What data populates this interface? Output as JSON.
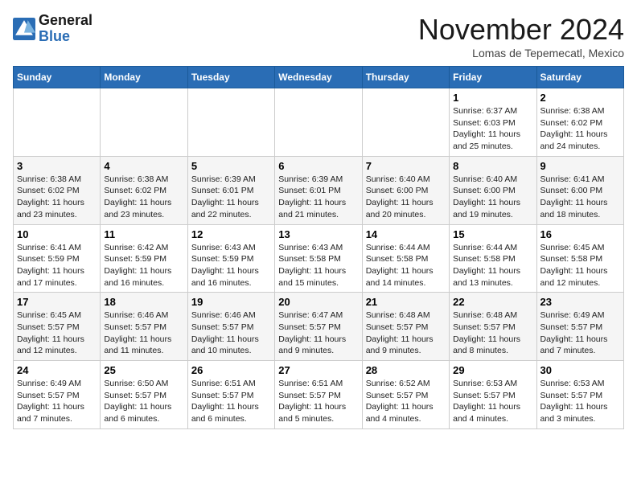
{
  "header": {
    "logo_line1": "General",
    "logo_line2": "Blue",
    "title": "November 2024",
    "location": "Lomas de Tepemecatl, Mexico"
  },
  "days_of_week": [
    "Sunday",
    "Monday",
    "Tuesday",
    "Wednesday",
    "Thursday",
    "Friday",
    "Saturday"
  ],
  "weeks": [
    [
      {
        "day": "",
        "info": ""
      },
      {
        "day": "",
        "info": ""
      },
      {
        "day": "",
        "info": ""
      },
      {
        "day": "",
        "info": ""
      },
      {
        "day": "",
        "info": ""
      },
      {
        "day": "1",
        "info": "Sunrise: 6:37 AM\nSunset: 6:03 PM\nDaylight: 11 hours and 25 minutes."
      },
      {
        "day": "2",
        "info": "Sunrise: 6:38 AM\nSunset: 6:02 PM\nDaylight: 11 hours and 24 minutes."
      }
    ],
    [
      {
        "day": "3",
        "info": "Sunrise: 6:38 AM\nSunset: 6:02 PM\nDaylight: 11 hours and 23 minutes."
      },
      {
        "day": "4",
        "info": "Sunrise: 6:38 AM\nSunset: 6:02 PM\nDaylight: 11 hours and 23 minutes."
      },
      {
        "day": "5",
        "info": "Sunrise: 6:39 AM\nSunset: 6:01 PM\nDaylight: 11 hours and 22 minutes."
      },
      {
        "day": "6",
        "info": "Sunrise: 6:39 AM\nSunset: 6:01 PM\nDaylight: 11 hours and 21 minutes."
      },
      {
        "day": "7",
        "info": "Sunrise: 6:40 AM\nSunset: 6:00 PM\nDaylight: 11 hours and 20 minutes."
      },
      {
        "day": "8",
        "info": "Sunrise: 6:40 AM\nSunset: 6:00 PM\nDaylight: 11 hours and 19 minutes."
      },
      {
        "day": "9",
        "info": "Sunrise: 6:41 AM\nSunset: 6:00 PM\nDaylight: 11 hours and 18 minutes."
      }
    ],
    [
      {
        "day": "10",
        "info": "Sunrise: 6:41 AM\nSunset: 5:59 PM\nDaylight: 11 hours and 17 minutes."
      },
      {
        "day": "11",
        "info": "Sunrise: 6:42 AM\nSunset: 5:59 PM\nDaylight: 11 hours and 16 minutes."
      },
      {
        "day": "12",
        "info": "Sunrise: 6:43 AM\nSunset: 5:59 PM\nDaylight: 11 hours and 16 minutes."
      },
      {
        "day": "13",
        "info": "Sunrise: 6:43 AM\nSunset: 5:58 PM\nDaylight: 11 hours and 15 minutes."
      },
      {
        "day": "14",
        "info": "Sunrise: 6:44 AM\nSunset: 5:58 PM\nDaylight: 11 hours and 14 minutes."
      },
      {
        "day": "15",
        "info": "Sunrise: 6:44 AM\nSunset: 5:58 PM\nDaylight: 11 hours and 13 minutes."
      },
      {
        "day": "16",
        "info": "Sunrise: 6:45 AM\nSunset: 5:58 PM\nDaylight: 11 hours and 12 minutes."
      }
    ],
    [
      {
        "day": "17",
        "info": "Sunrise: 6:45 AM\nSunset: 5:57 PM\nDaylight: 11 hours and 12 minutes."
      },
      {
        "day": "18",
        "info": "Sunrise: 6:46 AM\nSunset: 5:57 PM\nDaylight: 11 hours and 11 minutes."
      },
      {
        "day": "19",
        "info": "Sunrise: 6:46 AM\nSunset: 5:57 PM\nDaylight: 11 hours and 10 minutes."
      },
      {
        "day": "20",
        "info": "Sunrise: 6:47 AM\nSunset: 5:57 PM\nDaylight: 11 hours and 9 minutes."
      },
      {
        "day": "21",
        "info": "Sunrise: 6:48 AM\nSunset: 5:57 PM\nDaylight: 11 hours and 9 minutes."
      },
      {
        "day": "22",
        "info": "Sunrise: 6:48 AM\nSunset: 5:57 PM\nDaylight: 11 hours and 8 minutes."
      },
      {
        "day": "23",
        "info": "Sunrise: 6:49 AM\nSunset: 5:57 PM\nDaylight: 11 hours and 7 minutes."
      }
    ],
    [
      {
        "day": "24",
        "info": "Sunrise: 6:49 AM\nSunset: 5:57 PM\nDaylight: 11 hours and 7 minutes."
      },
      {
        "day": "25",
        "info": "Sunrise: 6:50 AM\nSunset: 5:57 PM\nDaylight: 11 hours and 6 minutes."
      },
      {
        "day": "26",
        "info": "Sunrise: 6:51 AM\nSunset: 5:57 PM\nDaylight: 11 hours and 6 minutes."
      },
      {
        "day": "27",
        "info": "Sunrise: 6:51 AM\nSunset: 5:57 PM\nDaylight: 11 hours and 5 minutes."
      },
      {
        "day": "28",
        "info": "Sunrise: 6:52 AM\nSunset: 5:57 PM\nDaylight: 11 hours and 4 minutes."
      },
      {
        "day": "29",
        "info": "Sunrise: 6:53 AM\nSunset: 5:57 PM\nDaylight: 11 hours and 4 minutes."
      },
      {
        "day": "30",
        "info": "Sunrise: 6:53 AM\nSunset: 5:57 PM\nDaylight: 11 hours and 3 minutes."
      }
    ]
  ]
}
